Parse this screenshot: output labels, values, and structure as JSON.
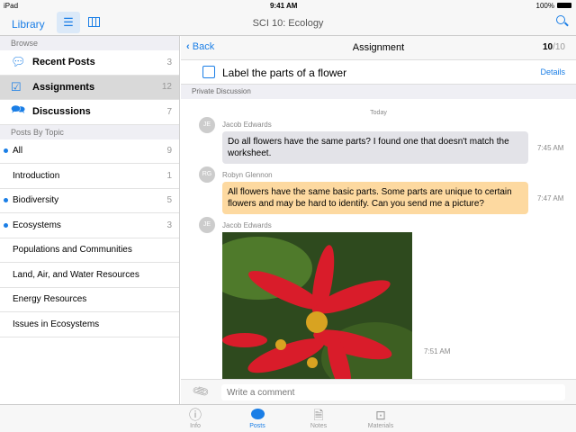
{
  "status": {
    "device": "iPad",
    "time": "9:41 AM",
    "battery": "100%"
  },
  "nav": {
    "library": "Library",
    "title": "SCI 10: Ecology"
  },
  "sidebar": {
    "browse_header": "Browse",
    "browse": [
      {
        "label": "Recent Posts",
        "count": "3"
      },
      {
        "label": "Assignments",
        "count": "12"
      },
      {
        "label": "Discussions",
        "count": "7"
      }
    ],
    "topics_header": "Posts By Topic",
    "topics": [
      {
        "label": "All",
        "count": "9"
      },
      {
        "label": "Introduction",
        "count": "1"
      },
      {
        "label": "Biodiversity",
        "count": "5"
      },
      {
        "label": "Ecosystems",
        "count": "3"
      },
      {
        "label": "Populations and Communities",
        "count": ""
      },
      {
        "label": "Land, Air, and Water Resources",
        "count": ""
      },
      {
        "label": "Energy Resources",
        "count": ""
      },
      {
        "label": "Issues in Ecosystems",
        "count": ""
      }
    ]
  },
  "detail": {
    "back": "Back",
    "title": "Assignment",
    "page_current": "10",
    "page_total": "/10",
    "assignment": "Label the parts of a flower",
    "details": "Details",
    "section": "Private Discussion",
    "day": "Today",
    "messages": [
      {
        "initials": "JE",
        "name": "Jacob Edwards",
        "text": "Do all flowers have the same parts? I found one that doesn't match the worksheet.",
        "time": "7:45 AM"
      },
      {
        "initials": "RG",
        "name": "Robyn Glennon",
        "text": "All flowers have the same basic parts. Some parts are unique to certain flowers and may be hard to identify. Can you send me a picture?",
        "time": "7:47 AM"
      },
      {
        "initials": "JE",
        "name": "Jacob Edwards",
        "time": "7:51 AM"
      }
    ],
    "comment_placeholder": "Write a comment"
  },
  "tabs": [
    {
      "label": "Info"
    },
    {
      "label": "Posts"
    },
    {
      "label": "Notes"
    },
    {
      "label": "Materials"
    }
  ],
  "colors": {
    "accent": "#1a7ee6",
    "teacher_bubble": "#fdd9a0",
    "student_bubble": "#e3e3e8"
  }
}
